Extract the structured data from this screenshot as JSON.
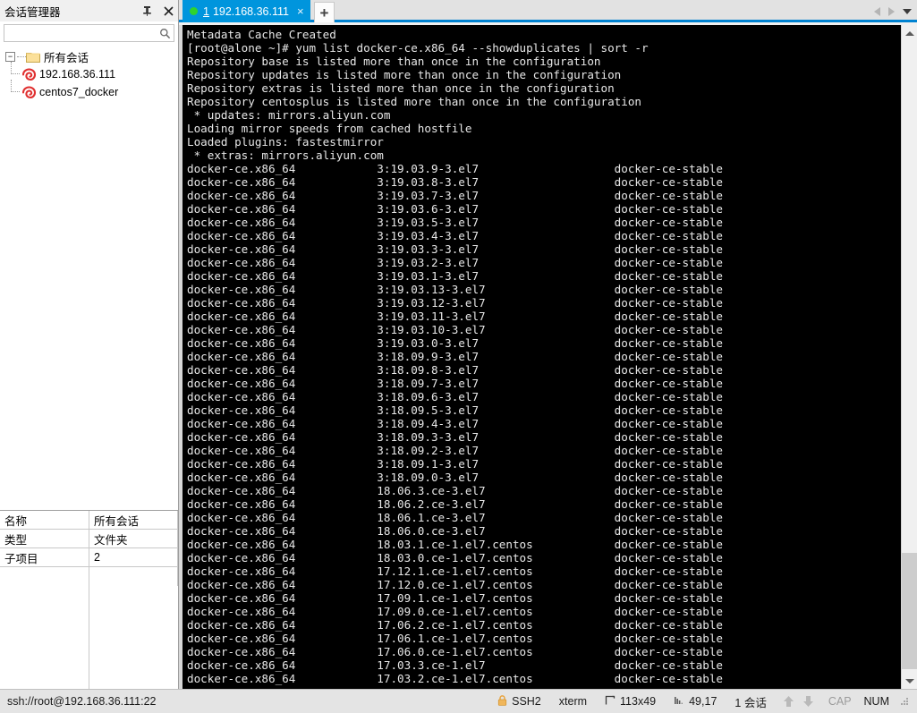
{
  "left_panel": {
    "title": "会话管理器",
    "pin_icon": "pin-icon",
    "close_icon": "close-icon",
    "search": {
      "value": "",
      "placeholder": "",
      "icon": "search-icon"
    },
    "tree": {
      "root": {
        "label": "所有会话",
        "icon": "folder-icon",
        "expander": "−"
      },
      "children": [
        {
          "label": "192.168.36.111",
          "icon": "session-icon"
        },
        {
          "label": "centos7_docker",
          "icon": "session-icon"
        }
      ]
    },
    "properties": [
      {
        "key": "名称",
        "value": "所有会话"
      },
      {
        "key": "类型",
        "value": "文件夹"
      },
      {
        "key": "子项目",
        "value": "2"
      }
    ]
  },
  "tabbar": {
    "active_tab": {
      "status_dot": "connected-dot-icon",
      "number": "1",
      "title": "192.168.36.111",
      "close_icon": "×"
    },
    "add_tab_label": "+",
    "prev_icon": "chevron-left-icon",
    "next_icon": "chevron-right-icon",
    "menu_icon": "chevron-down-icon"
  },
  "terminal": {
    "scroll_up_icon": "scroll-up-icon",
    "scroll_down_icon": "scroll-down-icon",
    "lines": [
      "Metadata Cache Created",
      "[root@alone ~]# yum list docker-ce.x86_64 --showduplicates | sort -r",
      "Repository base is listed more than once in the configuration",
      "Repository updates is listed more than once in the configuration",
      "Repository extras is listed more than once in the configuration",
      "Repository centosplus is listed more than once in the configuration",
      " * updates: mirrors.aliyun.com",
      "Loading mirror speeds from cached hostfile",
      "Loaded plugins: fastestmirror",
      " * extras: mirrors.aliyun.com",
      "docker-ce.x86_64            3:19.03.9-3.el7                    docker-ce-stable",
      "docker-ce.x86_64            3:19.03.8-3.el7                    docker-ce-stable",
      "docker-ce.x86_64            3:19.03.7-3.el7                    docker-ce-stable",
      "docker-ce.x86_64            3:19.03.6-3.el7                    docker-ce-stable",
      "docker-ce.x86_64            3:19.03.5-3.el7                    docker-ce-stable",
      "docker-ce.x86_64            3:19.03.4-3.el7                    docker-ce-stable",
      "docker-ce.x86_64            3:19.03.3-3.el7                    docker-ce-stable",
      "docker-ce.x86_64            3:19.03.2-3.el7                    docker-ce-stable",
      "docker-ce.x86_64            3:19.03.1-3.el7                    docker-ce-stable",
      "docker-ce.x86_64            3:19.03.13-3.el7                   docker-ce-stable",
      "docker-ce.x86_64            3:19.03.12-3.el7                   docker-ce-stable",
      "docker-ce.x86_64            3:19.03.11-3.el7                   docker-ce-stable",
      "docker-ce.x86_64            3:19.03.10-3.el7                   docker-ce-stable",
      "docker-ce.x86_64            3:19.03.0-3.el7                    docker-ce-stable",
      "docker-ce.x86_64            3:18.09.9-3.el7                    docker-ce-stable",
      "docker-ce.x86_64            3:18.09.8-3.el7                    docker-ce-stable",
      "docker-ce.x86_64            3:18.09.7-3.el7                    docker-ce-stable",
      "docker-ce.x86_64            3:18.09.6-3.el7                    docker-ce-stable",
      "docker-ce.x86_64            3:18.09.5-3.el7                    docker-ce-stable",
      "docker-ce.x86_64            3:18.09.4-3.el7                    docker-ce-stable",
      "docker-ce.x86_64            3:18.09.3-3.el7                    docker-ce-stable",
      "docker-ce.x86_64            3:18.09.2-3.el7                    docker-ce-stable",
      "docker-ce.x86_64            3:18.09.1-3.el7                    docker-ce-stable",
      "docker-ce.x86_64            3:18.09.0-3.el7                    docker-ce-stable",
      "docker-ce.x86_64            18.06.3.ce-3.el7                   docker-ce-stable",
      "docker-ce.x86_64            18.06.2.ce-3.el7                   docker-ce-stable",
      "docker-ce.x86_64            18.06.1.ce-3.el7                   docker-ce-stable",
      "docker-ce.x86_64            18.06.0.ce-3.el7                   docker-ce-stable",
      "docker-ce.x86_64            18.03.1.ce-1.el7.centos            docker-ce-stable",
      "docker-ce.x86_64            18.03.0.ce-1.el7.centos            docker-ce-stable",
      "docker-ce.x86_64            17.12.1.ce-1.el7.centos            docker-ce-stable",
      "docker-ce.x86_64            17.12.0.ce-1.el7.centos            docker-ce-stable",
      "docker-ce.x86_64            17.09.1.ce-1.el7.centos            docker-ce-stable",
      "docker-ce.x86_64            17.09.0.ce-1.el7.centos            docker-ce-stable",
      "docker-ce.x86_64            17.06.2.ce-1.el7.centos            docker-ce-stable",
      "docker-ce.x86_64            17.06.1.ce-1.el7.centos            docker-ce-stable",
      "docker-ce.x86_64            17.06.0.ce-1.el7.centos            docker-ce-stable",
      "docker-ce.x86_64            17.03.3.ce-1.el7                   docker-ce-stable",
      "docker-ce.x86_64            17.03.2.ce-1.el7.centos            docker-ce-stable"
    ]
  },
  "statusbar": {
    "connection": "ssh://root@192.168.36.111:22",
    "protocol": "SSH2",
    "protocol_icon": "lock-icon",
    "term_type": "xterm",
    "size_icon": "resize-icon",
    "size": "113x49",
    "cursor_icon": "cursor-pos-icon",
    "cursor": "49,17",
    "sessions": "1 会话",
    "upload_icon": "arrow-up-icon",
    "download_icon": "arrow-down-icon",
    "caps": "CAP",
    "num": "NUM",
    "grip_icon": "resize-grip-icon"
  },
  "colors": {
    "tab_active_bg": "#0095dd",
    "tabbar_underline": "#0082d1",
    "terminal_bg": "#000000",
    "terminal_fg": "#e8e8e8",
    "status_dot": "#2fd32f",
    "panel_bg": "#f0f0f0"
  }
}
